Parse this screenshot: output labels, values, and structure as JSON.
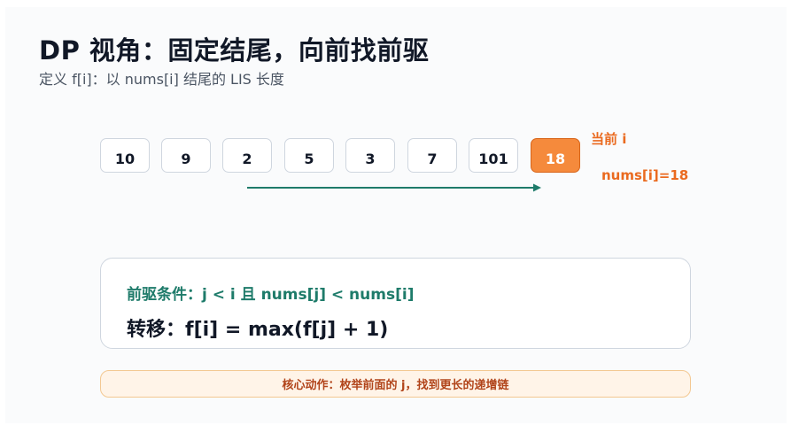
{
  "title": "DP 视角：固定结尾，向前找前驱",
  "subtitle": "定义 f[i]：以 nums[i] 结尾的 LIS 长度",
  "nums": [
    "10",
    "9",
    "2",
    "5",
    "3",
    "7",
    "101",
    "18"
  ],
  "current_index": 7,
  "current_label": "当前 i",
  "current_value": "nums[i]=18",
  "condition": "前驱条件：j < i 且 nums[j] < nums[i]",
  "transition": "转移：f[i] = max(f[j] + 1)",
  "note": "核心动作：枚举前面的 j，找到更长的递增链",
  "colors": {
    "accent_orange": "#f58a3c",
    "accent_teal": "#1e7b6a",
    "note_text": "#b1441a"
  }
}
